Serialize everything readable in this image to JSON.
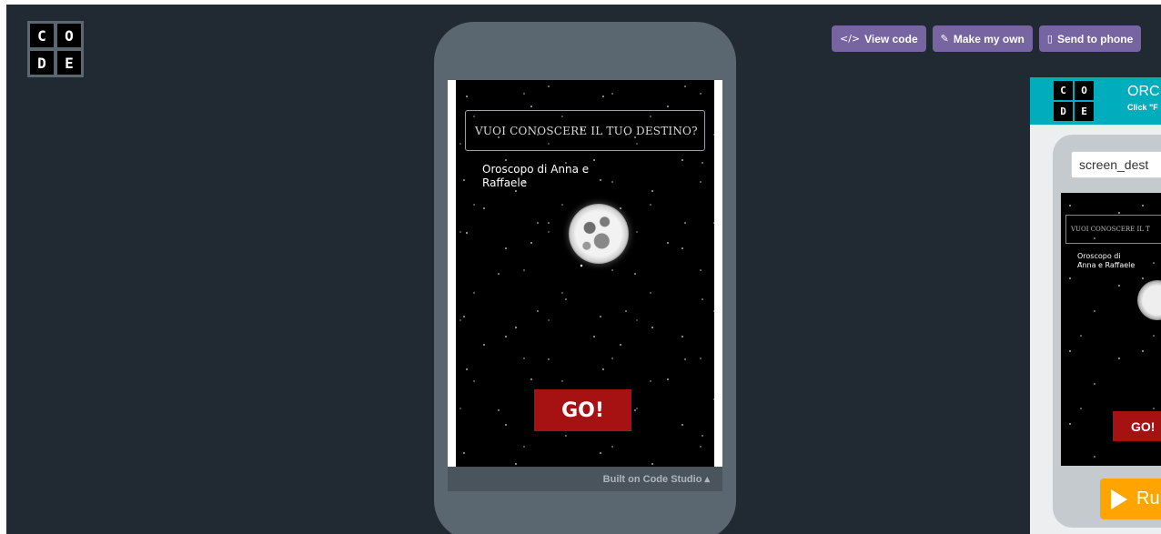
{
  "logo": {
    "letters": [
      "C",
      "O",
      "D",
      "E"
    ]
  },
  "toolbar": {
    "view_code_icon": "</>",
    "view_code_label": "View code",
    "make_own_icon": "✎",
    "make_own_label": "Make my own",
    "send_phone_icon": "▯",
    "send_phone_label": "Send to phone"
  },
  "app": {
    "fortune_text": "VUOI CONOSCERE IL TUO  DESTINO?",
    "subtitle": "Oroscopo di Anna e Raffaele",
    "go_label": "GO!",
    "built_on": "Built on Code Studio ▴"
  },
  "right_panel": {
    "title": "ORC",
    "subtitle": "Click \"F",
    "screen_select": "screen_dest",
    "fortune_text": "VUOI CONOSCERE IL T",
    "app_subtitle": "Oroscopo di Anna e Raffaele",
    "go_label": "GO!",
    "run_label": "Ru"
  },
  "colors": {
    "background": "#212a33",
    "button_purple": "#7665a0",
    "go_red": "#a61212",
    "header_teal": "#00adbc",
    "run_orange": "#ffa400"
  }
}
